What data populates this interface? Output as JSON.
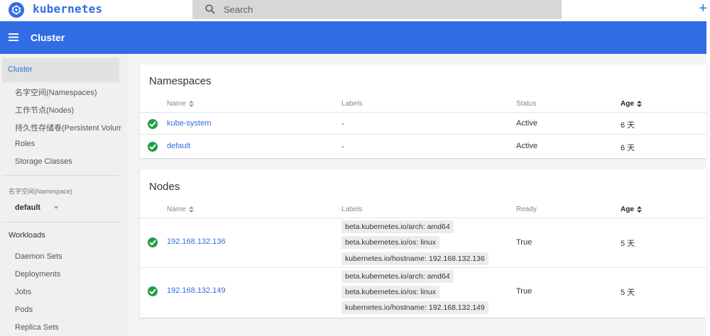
{
  "topbar": {
    "brand": "kubernetes",
    "search_placeholder": "Search",
    "plus": "+"
  },
  "header": {
    "title": "Cluster"
  },
  "sidebar": {
    "active": "Cluster",
    "items": [
      "名字空间(Namespaces)",
      "工作节点(Nodes)",
      "持久性存储卷(Persistent Volumes)",
      "Roles",
      "Storage Classes"
    ],
    "namespace_label": "名字空间(Namespace)",
    "namespace_value": "default",
    "workloads_label": "Workloads",
    "workloads": [
      "Daemon Sets",
      "Deployments",
      "Jobs",
      "Pods",
      "Replica Sets"
    ]
  },
  "namespaces": {
    "title": "Namespaces",
    "columns": [
      "Name",
      "Labels",
      "Status",
      "Age"
    ],
    "rows": [
      {
        "name": "kube-system",
        "labels": "-",
        "status": "Active",
        "age": "6 天"
      },
      {
        "name": "default",
        "labels": "-",
        "status": "Active",
        "age": "6 天"
      }
    ]
  },
  "nodes": {
    "title": "Nodes",
    "columns": [
      "Name",
      "Labels",
      "Ready",
      "Age"
    ],
    "rows": [
      {
        "name": "192.168.132.136",
        "labels": [
          "beta.kubernetes.io/arch: amd64",
          "beta.kubernetes.io/os: linux",
          "kubernetes.io/hostname: 192.168.132.136"
        ],
        "ready": "True",
        "age": "5 天"
      },
      {
        "name": "192.168.132.149",
        "labels": [
          "beta.kubernetes.io/arch: amd64",
          "beta.kubernetes.io/os: linux",
          "kubernetes.io/hostname: 192.168.132.149"
        ],
        "ready": "True",
        "age": "5 天"
      }
    ]
  },
  "colors": {
    "accent": "#326ce5",
    "success": "#1f9d4b"
  }
}
